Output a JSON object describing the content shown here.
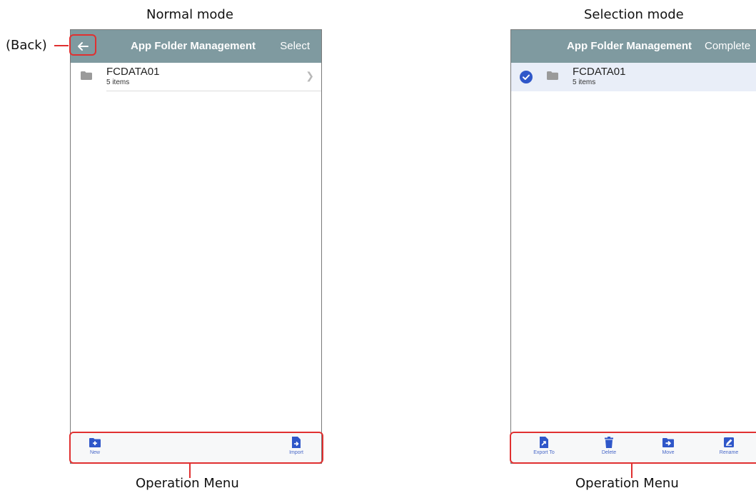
{
  "left_panel": {
    "caption": "Normal mode",
    "header": {
      "title": "App Folder Management",
      "action": "Select"
    },
    "items": [
      {
        "name": "FCDATA01",
        "count": "5 items"
      }
    ],
    "toolbar": [
      {
        "label": "New",
        "icon": "folder-plus-icon"
      },
      {
        "label": "Import",
        "icon": "file-import-icon"
      }
    ]
  },
  "right_panel": {
    "caption": "Selection mode",
    "header": {
      "title": "App Folder Management",
      "action": "Complete"
    },
    "items": [
      {
        "name": "FCDATA01",
        "count": "5 items",
        "selected": true
      }
    ],
    "toolbar": [
      {
        "label": "Export To",
        "icon": "file-export-icon"
      },
      {
        "label": "Delete",
        "icon": "trash-icon"
      },
      {
        "label": "Move",
        "icon": "folder-move-icon"
      },
      {
        "label": "Rename",
        "icon": "pencil-icon"
      }
    ]
  },
  "annotations": {
    "back": "(Back)",
    "operation_menu": "Operation Menu"
  },
  "colors": {
    "header_bg": "#7f9aa0",
    "accent": "#2f57c9",
    "highlight": "#e03030"
  }
}
